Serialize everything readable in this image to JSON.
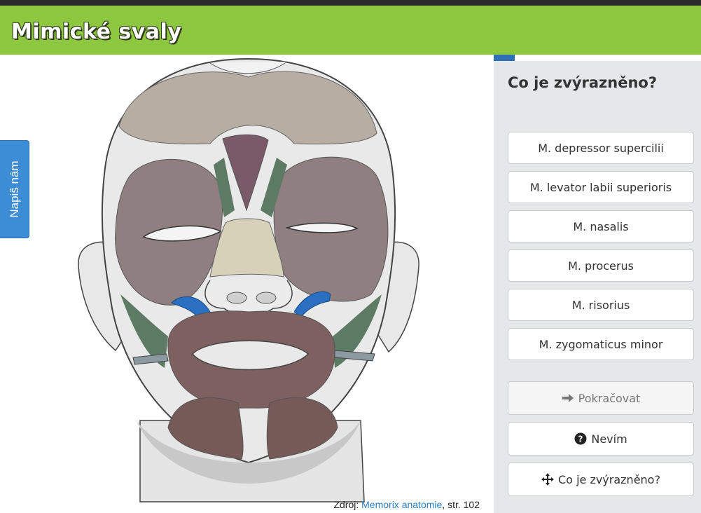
{
  "header": {
    "title": "Mimické svaly"
  },
  "feedback": {
    "label": "Napiš nám"
  },
  "source": {
    "prefix": "Zdroj:",
    "link": "Memorix anatomie",
    "suffix": ", str. 102"
  },
  "quiz": {
    "question": "Co je zvýrazněno?",
    "answers": [
      "M. depressor supercilii",
      "M. levator labii superioris",
      "M. nasalis",
      "M. procerus",
      "M. risorius",
      "M. zygomaticus minor"
    ],
    "actions": {
      "continue": "Pokračovat",
      "dont_know": "Nevím",
      "highlight": "Co je zvýrazněno?"
    }
  },
  "icons": [
    "arrow-right-icon",
    "question-circle-icon",
    "crosshair-icon"
  ],
  "colors": {
    "header": "#8dc63f",
    "feedback_tab": "#3c8dd6",
    "panel": "#e6e7e8",
    "highlight_muscle": "#2a6fc0",
    "link": "#2a7ec2"
  }
}
